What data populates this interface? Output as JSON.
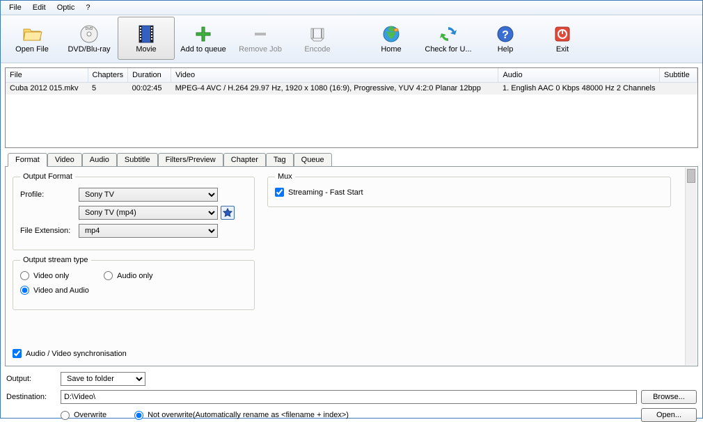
{
  "menu": {
    "file": "File",
    "edit": "Edit",
    "options": "Optic",
    "help": "?"
  },
  "toolbar": {
    "open_file": "Open File",
    "dvd": "DVD/Blu-ray",
    "movie": "Movie",
    "add": "Add to queue",
    "remove": "Remove Job",
    "encode": "Encode",
    "home": "Home",
    "check": "Check for U...",
    "help": "Help",
    "exit": "Exit"
  },
  "filelist": {
    "headers": {
      "file": "File",
      "chapters": "Chapters",
      "duration": "Duration",
      "video": "Video",
      "audio": "Audio",
      "subtitle": "Subtitle"
    },
    "row": {
      "file": "Cuba 2012 015.mkv",
      "chapters": "5",
      "duration": "00:02:45",
      "video": "MPEG-4 AVC / H.264 29.97 Hz, 1920 x 1080 (16:9), Progressive, YUV 4:2:0 Planar 12bpp",
      "audio": "1. English AAC  0 Kbps 48000 Hz 2 Channels",
      "subtitle": ""
    }
  },
  "tabs": {
    "format": "Format",
    "video": "Video",
    "audio": "Audio",
    "subtitle": "Subtitle",
    "filters": "Filters/Preview",
    "chapter": "Chapter",
    "tag": "Tag",
    "queue": "Queue"
  },
  "format_panel": {
    "output_format_legend": "Output Format",
    "profile_label": "Profile:",
    "profile_value": "Sony TV",
    "container_value": "Sony TV (mp4)",
    "file_ext_label": "File Extension:",
    "file_ext_value": "mp4",
    "mux_legend": "Mux",
    "streaming_label": "Streaming - Fast Start",
    "output_stream_legend": "Output stream type",
    "video_only": "Video only",
    "audio_only": "Audio only",
    "video_and_audio": "Video and Audio",
    "av_sync": "Audio / Video synchronisation"
  },
  "bottom": {
    "output_label": "Output:",
    "output_value": "Save to folder",
    "dest_label": "Destination:",
    "dest_value": "D:\\Video\\",
    "browse": "Browse...",
    "open": "Open...",
    "overwrite": "Overwrite",
    "not_overwrite": "Not overwrite(Automatically rename as <filename + index>)"
  }
}
